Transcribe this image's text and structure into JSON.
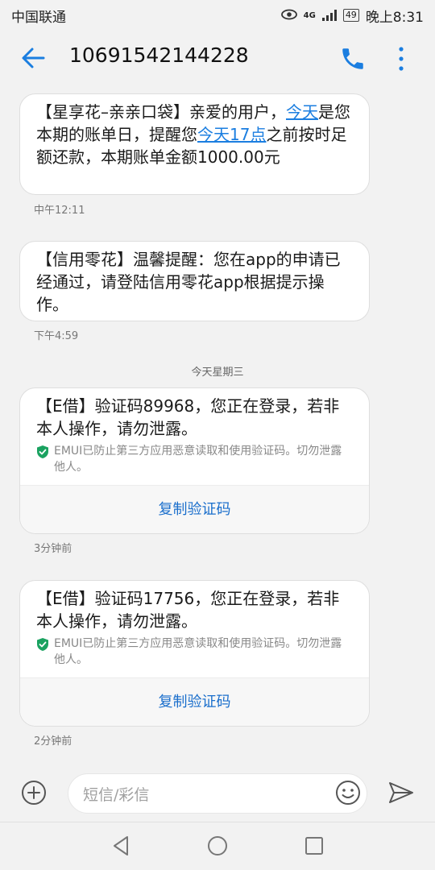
{
  "status_bar": {
    "carrier": "中国联通",
    "network": "4G",
    "battery": "49",
    "time": "晚上8:31"
  },
  "header": {
    "title": "10691542144228",
    "icons": [
      "back-arrow-icon",
      "phone-icon",
      "more-vertical-icon"
    ]
  },
  "messages": [
    {
      "segments": [
        {
          "text": "【星享花–亲亲口袋】亲爱的用户，",
          "link": false
        },
        {
          "text": "今天",
          "link": true
        },
        {
          "text": "是您本期的账单日，提醒您",
          "link": false
        },
        {
          "text": "今天17点",
          "link": true
        },
        {
          "text": "之前按时足额还款，本期账单金额1000.00元",
          "link": false
        }
      ],
      "time": "中午12:11"
    },
    {
      "segments": [
        {
          "text": "【信用零花】温馨提醒：您在app的申请已经通过，请登陆信用零花app根据提示操作。",
          "link": false
        }
      ],
      "time": "下午4:59"
    }
  ],
  "date_separator": "今天星期三",
  "verify_messages": [
    {
      "text": "【E借】验证码89968，您正在登录，若非本人操作，请勿泄露。",
      "notice": "EMUI已防止第三方应用恶意读取和使用验证码。切勿泄露他人。",
      "button": "复制验证码",
      "time": "3分钟前"
    },
    {
      "text": "【E借】验证码17756，您正在登录，若非本人操作，请勿泄露。",
      "notice": "EMUI已防止第三方应用恶意读取和使用验证码。切勿泄露他人。",
      "button": "复制验证码",
      "time": "2分钟前"
    }
  ],
  "input_bar": {
    "placeholder": "短信/彩信"
  },
  "colors": {
    "accent": "#1b7ee0",
    "shield": "#1aa260",
    "background": "#f2f2f2"
  }
}
